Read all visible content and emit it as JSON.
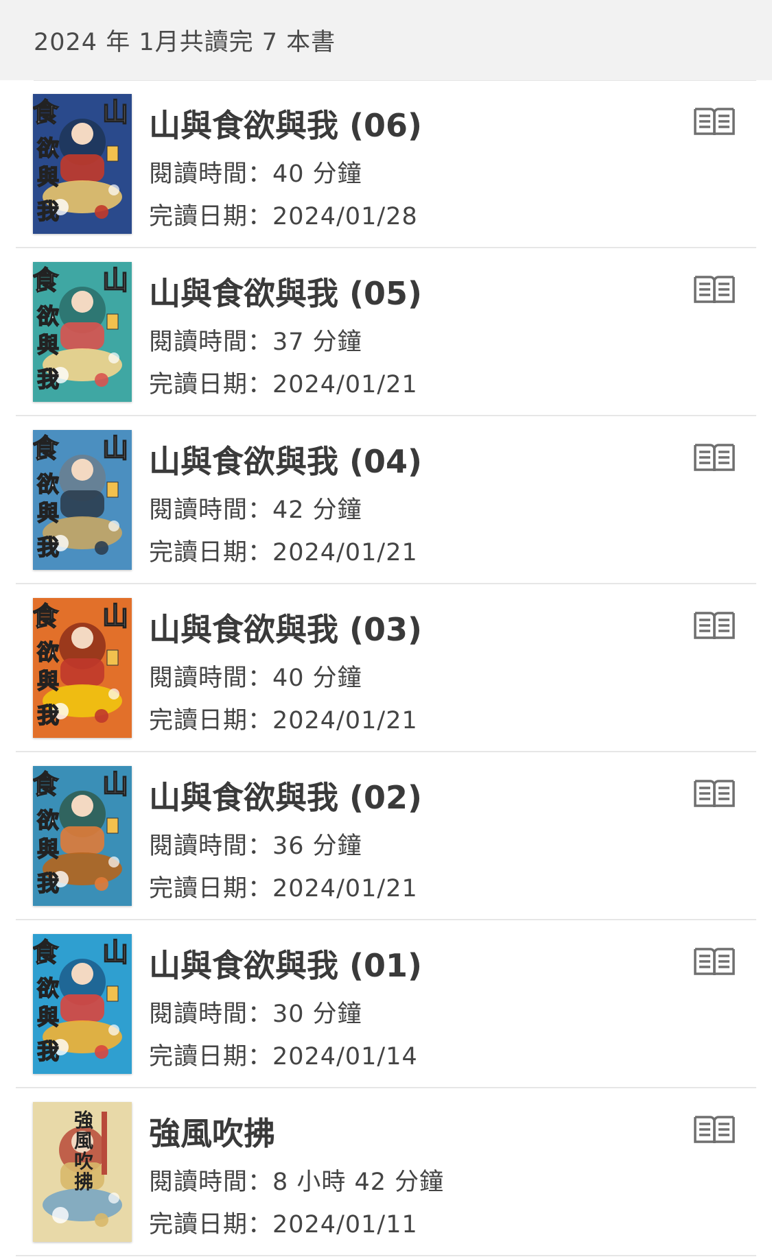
{
  "header": {
    "title": "2024 年 1月共讀完 7 本書"
  },
  "books": [
    {
      "title": "山與食欲與我 (06)",
      "reading_time": "閱讀時間：40 分鐘",
      "finished_date": "完讀日期：2024/01/28",
      "cover_palette": [
        "#2a4a8c",
        "#c23a2a",
        "#e9c46a",
        "#1d3557"
      ],
      "cover_title_chars": [
        "食",
        "欲",
        "與",
        "我",
        "山"
      ]
    },
    {
      "title": "山與食欲與我 (05)",
      "reading_time": "閱讀時間：37 分鐘",
      "finished_date": "完讀日期：2024/01/21",
      "cover_palette": [
        "#3fa7a3",
        "#d9534f",
        "#f4d58d",
        "#2b6f6b"
      ],
      "cover_title_chars": [
        "食",
        "欲",
        "與",
        "我",
        "山"
      ]
    },
    {
      "title": "山與食欲與我 (04)",
      "reading_time": "閱讀時間：42 分鐘",
      "finished_date": "完讀日期：2024/01/21",
      "cover_palette": [
        "#4b8fc0",
        "#2c3e50",
        "#c6a664",
        "#6b7f8e"
      ],
      "cover_title_chars": [
        "食",
        "欲",
        "與",
        "我",
        "山"
      ]
    },
    {
      "title": "山與食欲與我 (03)",
      "reading_time": "閱讀時間：40 分鐘",
      "finished_date": "完讀日期：2024/01/21",
      "cover_palette": [
        "#e2702a",
        "#c0392b",
        "#f1c40f",
        "#8e2f1a"
      ],
      "cover_title_chars": [
        "食",
        "欲",
        "與",
        "我",
        "山"
      ]
    },
    {
      "title": "山與食欲與我 (02)",
      "reading_time": "閱讀時間：36 分鐘",
      "finished_date": "完讀日期：2024/01/21",
      "cover_palette": [
        "#3a8fb7",
        "#e07b39",
        "#b5651d",
        "#2f5d50"
      ],
      "cover_title_chars": [
        "食",
        "欲",
        "與",
        "我",
        "山"
      ]
    },
    {
      "title": "山與食欲與我 (01)",
      "reading_time": "閱讀時間：30 分鐘",
      "finished_date": "完讀日期：2024/01/14",
      "cover_palette": [
        "#2f9fd0",
        "#d9463e",
        "#f2b134",
        "#1c5d8c"
      ],
      "cover_title_chars": [
        "食",
        "欲",
        "與",
        "我",
        "山"
      ]
    },
    {
      "title": "強風吹拂",
      "reading_time": "閱讀時間：8 小時 42 分鐘",
      "finished_date": "完讀日期：2024/01/11",
      "cover_palette": [
        "#e8d9a8",
        "#d8b86a",
        "#7aa6c2",
        "#b84a3a"
      ],
      "cover_title_chars": [
        "強",
        "風",
        "吹",
        "拂"
      ]
    }
  ],
  "icons": {
    "row_action": "open-book-icon"
  },
  "colors": {
    "header_bg": "#f2f2f2",
    "separator": "#e6e6e6",
    "text": "#3a3a3a"
  }
}
